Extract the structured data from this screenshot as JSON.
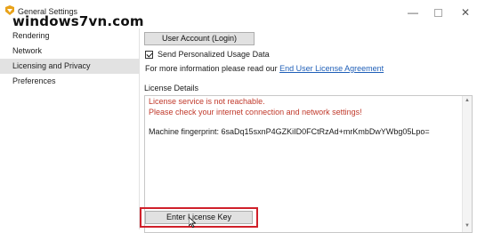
{
  "window": {
    "title": "General Settings",
    "watermark": "windows7vn.com",
    "controls": [
      "minimize",
      "maximize",
      "close"
    ]
  },
  "sidebar": {
    "items": [
      {
        "label": "Rendering",
        "active": false
      },
      {
        "label": "Network",
        "active": false
      },
      {
        "label": "Licensing and Privacy",
        "active": true
      },
      {
        "label": "Preferences",
        "active": false
      }
    ]
  },
  "licensing": {
    "user_account_button": "User Account (Login)",
    "send_usage_label": "Send Personalized Usage Data",
    "send_usage_checked": true,
    "info_prefix": "For more information please read our ",
    "eula_link": "End User License Agreement",
    "details_label": "License Details",
    "error_line1": "License service is not reachable.",
    "error_line2": "Please check your internet connection and network settings!",
    "fingerprint": "Machine fingerprint: 6saDq15sxnP4GZKiID0FCtRzAd+mrKmbDwYWbg05Lpo=",
    "enter_key_button": "Enter License Key"
  },
  "colors": {
    "error_text": "#c0392b",
    "link": "#1f5fb8",
    "highlight_box": "#d0202a",
    "sidebar_active": "#e2e2e2"
  }
}
